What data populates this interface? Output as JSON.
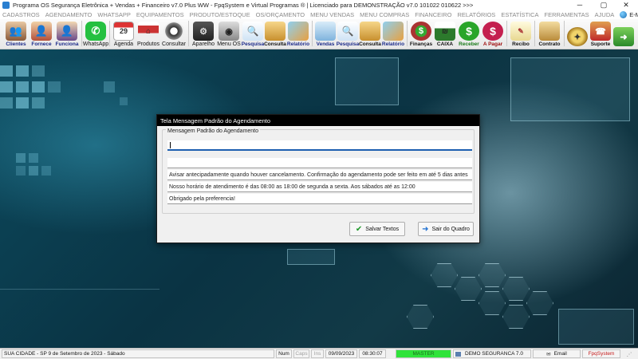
{
  "window": {
    "title": "Programa OS Segurança Eletrônica + Vendas + Financeiro v7.0 Plus WW - FpqSystem e Virtual Programas ® | Licenciado para  DEMONSTRAÇÃO v7.0 101022 010622 >>>",
    "minimize": "─",
    "maximize": "▢",
    "close": "✕"
  },
  "menu": {
    "items": [
      "CADASTROS",
      "AGENDAMENTO",
      "WHATSAPP",
      "EQUIPAMENTOS",
      "PRODUTO/ESTOQUE",
      "OS/ORÇAMENTO",
      "MENU VENDAS",
      "MENU COMPRAS",
      "FINANCEIRO",
      "RELATÓRIOS",
      "ESTATÍSTICA",
      "FERRAMENTAS",
      "AJUDA"
    ],
    "email": "E-MAIL"
  },
  "toolbar": {
    "clientes": "Clientes",
    "fornece": "Fornece",
    "funciona": "Funciona",
    "whatsapp": "WhatsApp",
    "agenda": "Agenda",
    "agenda_day": "29",
    "produtos": "Produtos",
    "consultar": "Consultar",
    "aparelho": "Aparelho",
    "menu_os": "Menu OS",
    "pesquisa1": "Pesquisa",
    "consulta1": "Consulta",
    "relatorio1": "Relatório",
    "vendas": "Vendas",
    "pesquisa2": "Pesquisa",
    "consulta2": "Consulta",
    "relatorio2": "Relatório",
    "financas": "Finanças",
    "caixa": "CAIXA",
    "receber": "Receber",
    "a_pagar": "A Pagar",
    "recibo": "Recibo",
    "contrato": "Contrato",
    "suporte": "Suporte"
  },
  "dialog": {
    "title": "Tela Mensagem Padrão do Agendamento",
    "group_label": "Mensagem Padrão do Agendamento",
    "lines": [
      "",
      "",
      "Avisar antecipadamente quando houver cancelamento. Confirmação do agendamento pode ser feito em até 5 dias antes",
      "Nosso horário de atendimento é das 08:00 as 18:00 de segunda a sexta. Aos sábados até as 12:00",
      "Obrigado pela preferencia!"
    ],
    "save_label": "Salvar Textos",
    "exit_label": "Sair do Quadro"
  },
  "status": {
    "city_date": "SUA CIDADE - SP  9 de Setembro de 2023 - Sábado",
    "num": "Num",
    "caps": "Caps",
    "ins": "Ins",
    "date": "09/09/2023",
    "time": "08:30:07",
    "master": "MASTER",
    "demo": "DEMO SEGURANCA 7.0",
    "email": "Email",
    "brand": "FpqSystem"
  },
  "colors": {
    "toolbar_label": "#1b2a8a",
    "dialog_title_bg": "#000000",
    "focus_border": "#1e5fb0",
    "status_master": "#2fe33a"
  }
}
